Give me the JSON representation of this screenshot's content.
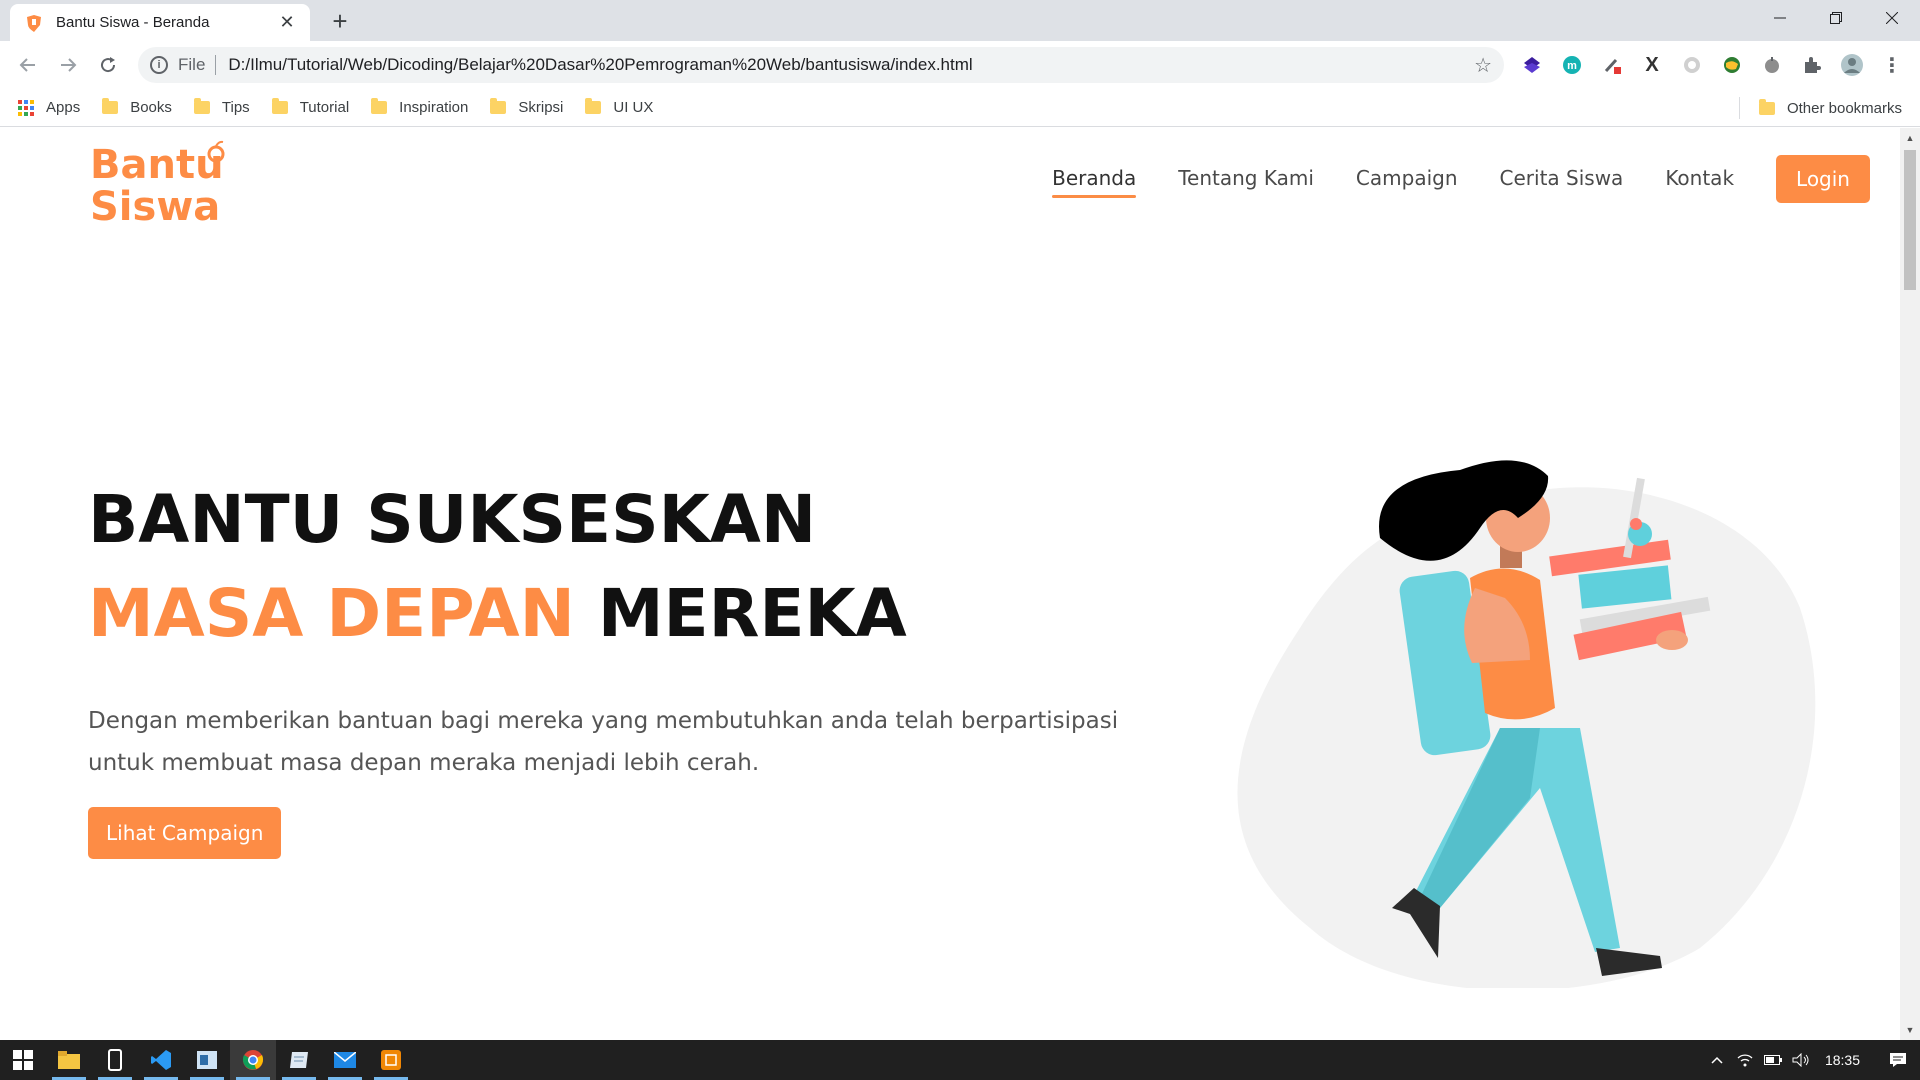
{
  "browser": {
    "tab_title": "Bantu Siswa - Beranda",
    "url_scheme": "File",
    "url": "D:/Ilmu/Tutorial/Web/Dicoding/Belajar%20Dasar%20Pemrograman%20Web/bantusiswa/index.html",
    "bookmarks": [
      "Apps",
      "Books",
      "Tips",
      "Tutorial",
      "Inspiration",
      "Skripsi",
      "UI UX"
    ],
    "other_bookmarks": "Other bookmarks"
  },
  "site": {
    "logo_line1": "Bantu",
    "logo_line2": "Siswa",
    "nav": [
      "Beranda",
      "Tentang Kami",
      "Campaign",
      "Cerita Siswa",
      "Kontak"
    ],
    "login": "Login",
    "hero_line1": "BANTU SUKSESKAN",
    "hero_accent": "MASA DEPAN",
    "hero_rest": "MEREKA",
    "hero_paragraph": "Dengan memberikan bantuan bagi mereka yang membutuhkan anda telah berpartisipasi untuk membuat masa depan meraka menjadi lebih cerah.",
    "cta": "Lihat Campaign",
    "accent_color": "#fd8c45"
  },
  "taskbar": {
    "time": "18:35"
  }
}
